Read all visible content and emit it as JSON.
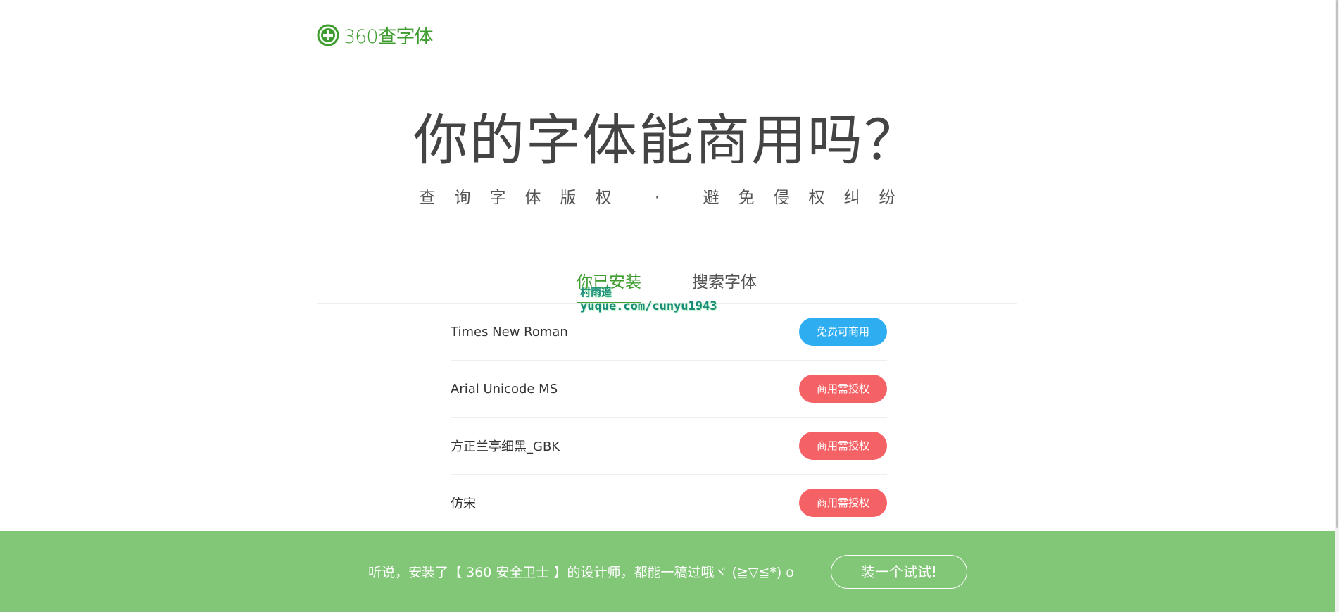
{
  "logo": {
    "text": "360查字体",
    "brand_color": "#3f9d2f",
    "icon": "plus-circle-icon"
  },
  "hero": {
    "title": "你的字体能商用吗？",
    "subtitle": "查询字体版权 · 避免侵权纠纷"
  },
  "tabs": [
    {
      "label": "你已安装",
      "active": true
    },
    {
      "label": "搜索字体",
      "active": false
    }
  ],
  "watermark": {
    "line1": "村雨遥",
    "line2": "yuque.com/cunyu1943"
  },
  "fonts": [
    {
      "name": "Times New Roman",
      "license": "免费可商用",
      "status": "free"
    },
    {
      "name": "Arial Unicode MS",
      "license": "商用需授权",
      "status": "paid"
    },
    {
      "name": "方正兰亭细黑_GBK",
      "license": "商用需授权",
      "status": "paid"
    },
    {
      "name": "仿宋",
      "license": "商用需授权",
      "status": "paid"
    }
  ],
  "banner": {
    "text": "听说，安装了【 360 安全卫士 】的设计师，都能一稿过哦ヾ (≧▽≦*) o",
    "button_label": "装一个试试!",
    "background": "#82c777"
  },
  "colors": {
    "free_badge": "#2eaef0",
    "paid_badge": "#f56266"
  }
}
